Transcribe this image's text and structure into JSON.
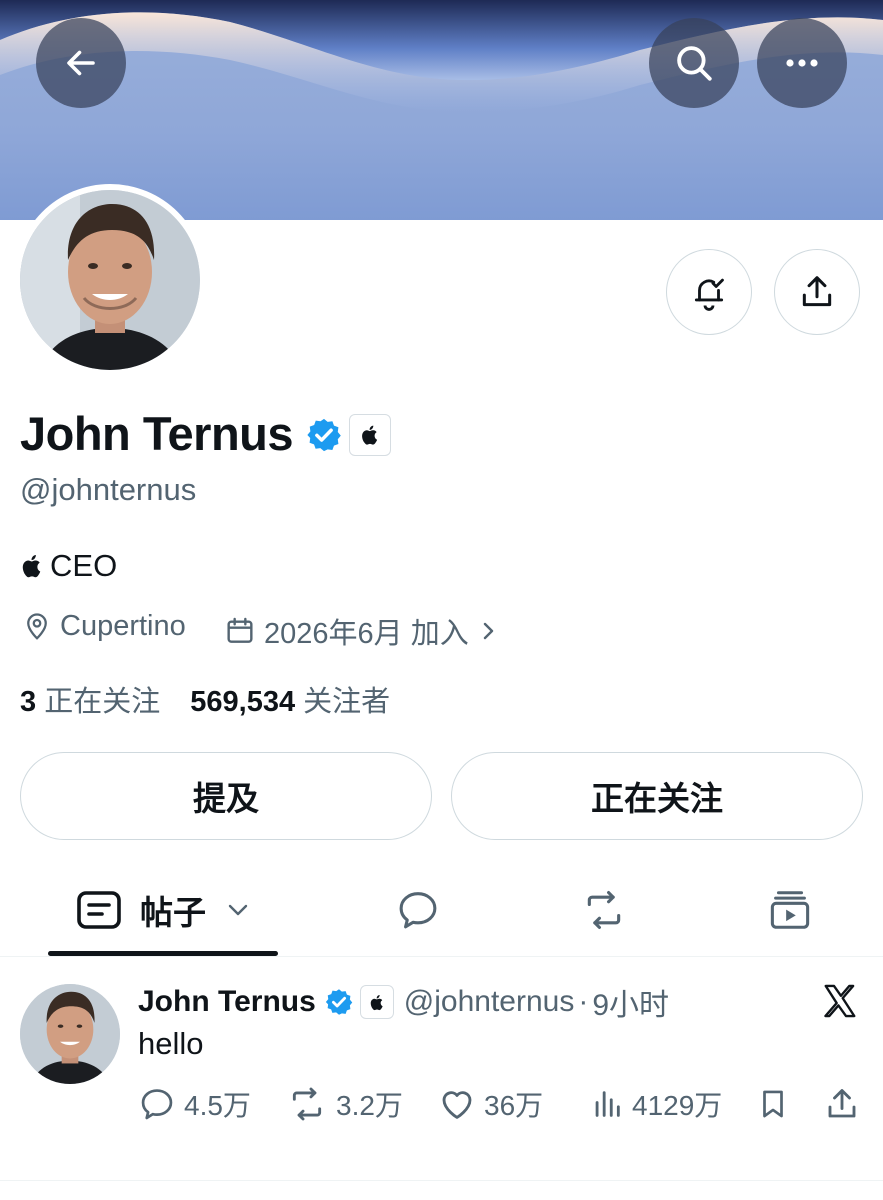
{
  "profile": {
    "name": "John Ternus",
    "handle": "@johnternus",
    "bio": "CEO",
    "location": "Cupertino",
    "joined": "2026年6月 加入",
    "following_count": "3",
    "following_label": "正在关注",
    "followers_count": "569,534",
    "followers_label": "关注者"
  },
  "buttons": {
    "mentions": "提及",
    "following": "正在关注"
  },
  "tabs": {
    "posts": "帖子"
  },
  "post": {
    "name": "John Ternus",
    "handle": "@johnternus",
    "separator": "·",
    "time": "9小时",
    "text": "hello",
    "replies": "4.5万",
    "reposts": "3.2万",
    "likes": "36万",
    "views": "4129万"
  },
  "colors": {
    "verified": "#1d9bf0",
    "text": "#0f1419",
    "secondary": "#536471",
    "border": "#cfd9de"
  },
  "icons": [
    "back-arrow-icon",
    "search-icon",
    "more-icon",
    "notification-bell-icon",
    "share-icon",
    "verified-icon",
    "apple-logo-icon",
    "location-pin-icon",
    "calendar-icon",
    "chevron-right-icon",
    "posts-icon",
    "chevron-down-icon",
    "reply-bubble-icon",
    "repost-icon",
    "media-icon",
    "x-logo-icon",
    "heart-icon",
    "views-icon",
    "bookmark-icon"
  ]
}
